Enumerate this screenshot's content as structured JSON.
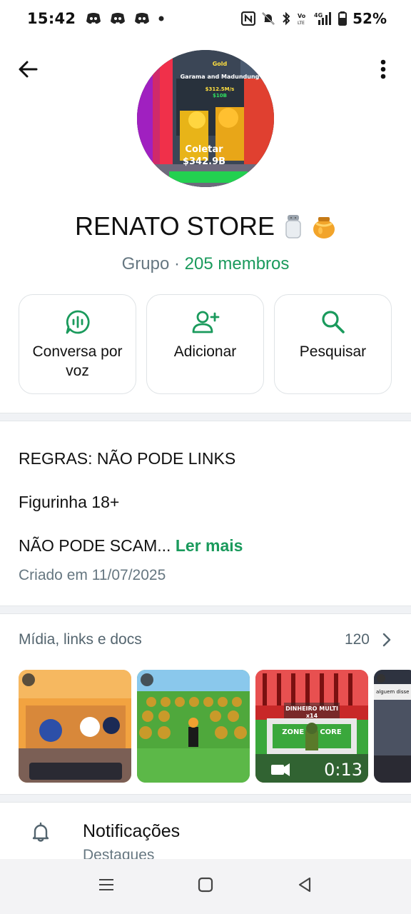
{
  "status_bar": {
    "time": "15:42",
    "battery": "52%"
  },
  "group": {
    "name": "RENATO STORE",
    "type_label": "Grupo",
    "separator": "·",
    "members": "205 membros"
  },
  "avatar_overlay": {
    "top_text": "Gold",
    "subtitle": "Garama and Madundung",
    "rate": "$312.5M/s",
    "cost": "$10B",
    "collect_label": "Coletar",
    "collect_value": "$342.9B"
  },
  "actions": [
    {
      "label": "Conversa por voz"
    },
    {
      "label": "Adicionar"
    },
    {
      "label": "Pesquisar"
    }
  ],
  "description": {
    "line1": "REGRAS: NÃO PODE LINKS",
    "line2": "Figurinha 18+",
    "line3": "NÃO PODE SCAM...",
    "read_more": "Ler mais",
    "created": "Criado em 11/07/2025"
  },
  "media": {
    "title": "Mídia, links e docs",
    "count": "120",
    "thumb3_banner": "DINHEIRO MULTI",
    "thumb3_multiplier": "x14",
    "thumb3_zone": "ZONE DE CORE",
    "thumb3_duration": "0:13",
    "thumb4_caption": "alguem disse la"
  },
  "notifications": {
    "title": "Notificações",
    "subtitle": "Destaques"
  },
  "colors": {
    "accent": "#1a9a5c",
    "text_secondary": "#667781"
  }
}
